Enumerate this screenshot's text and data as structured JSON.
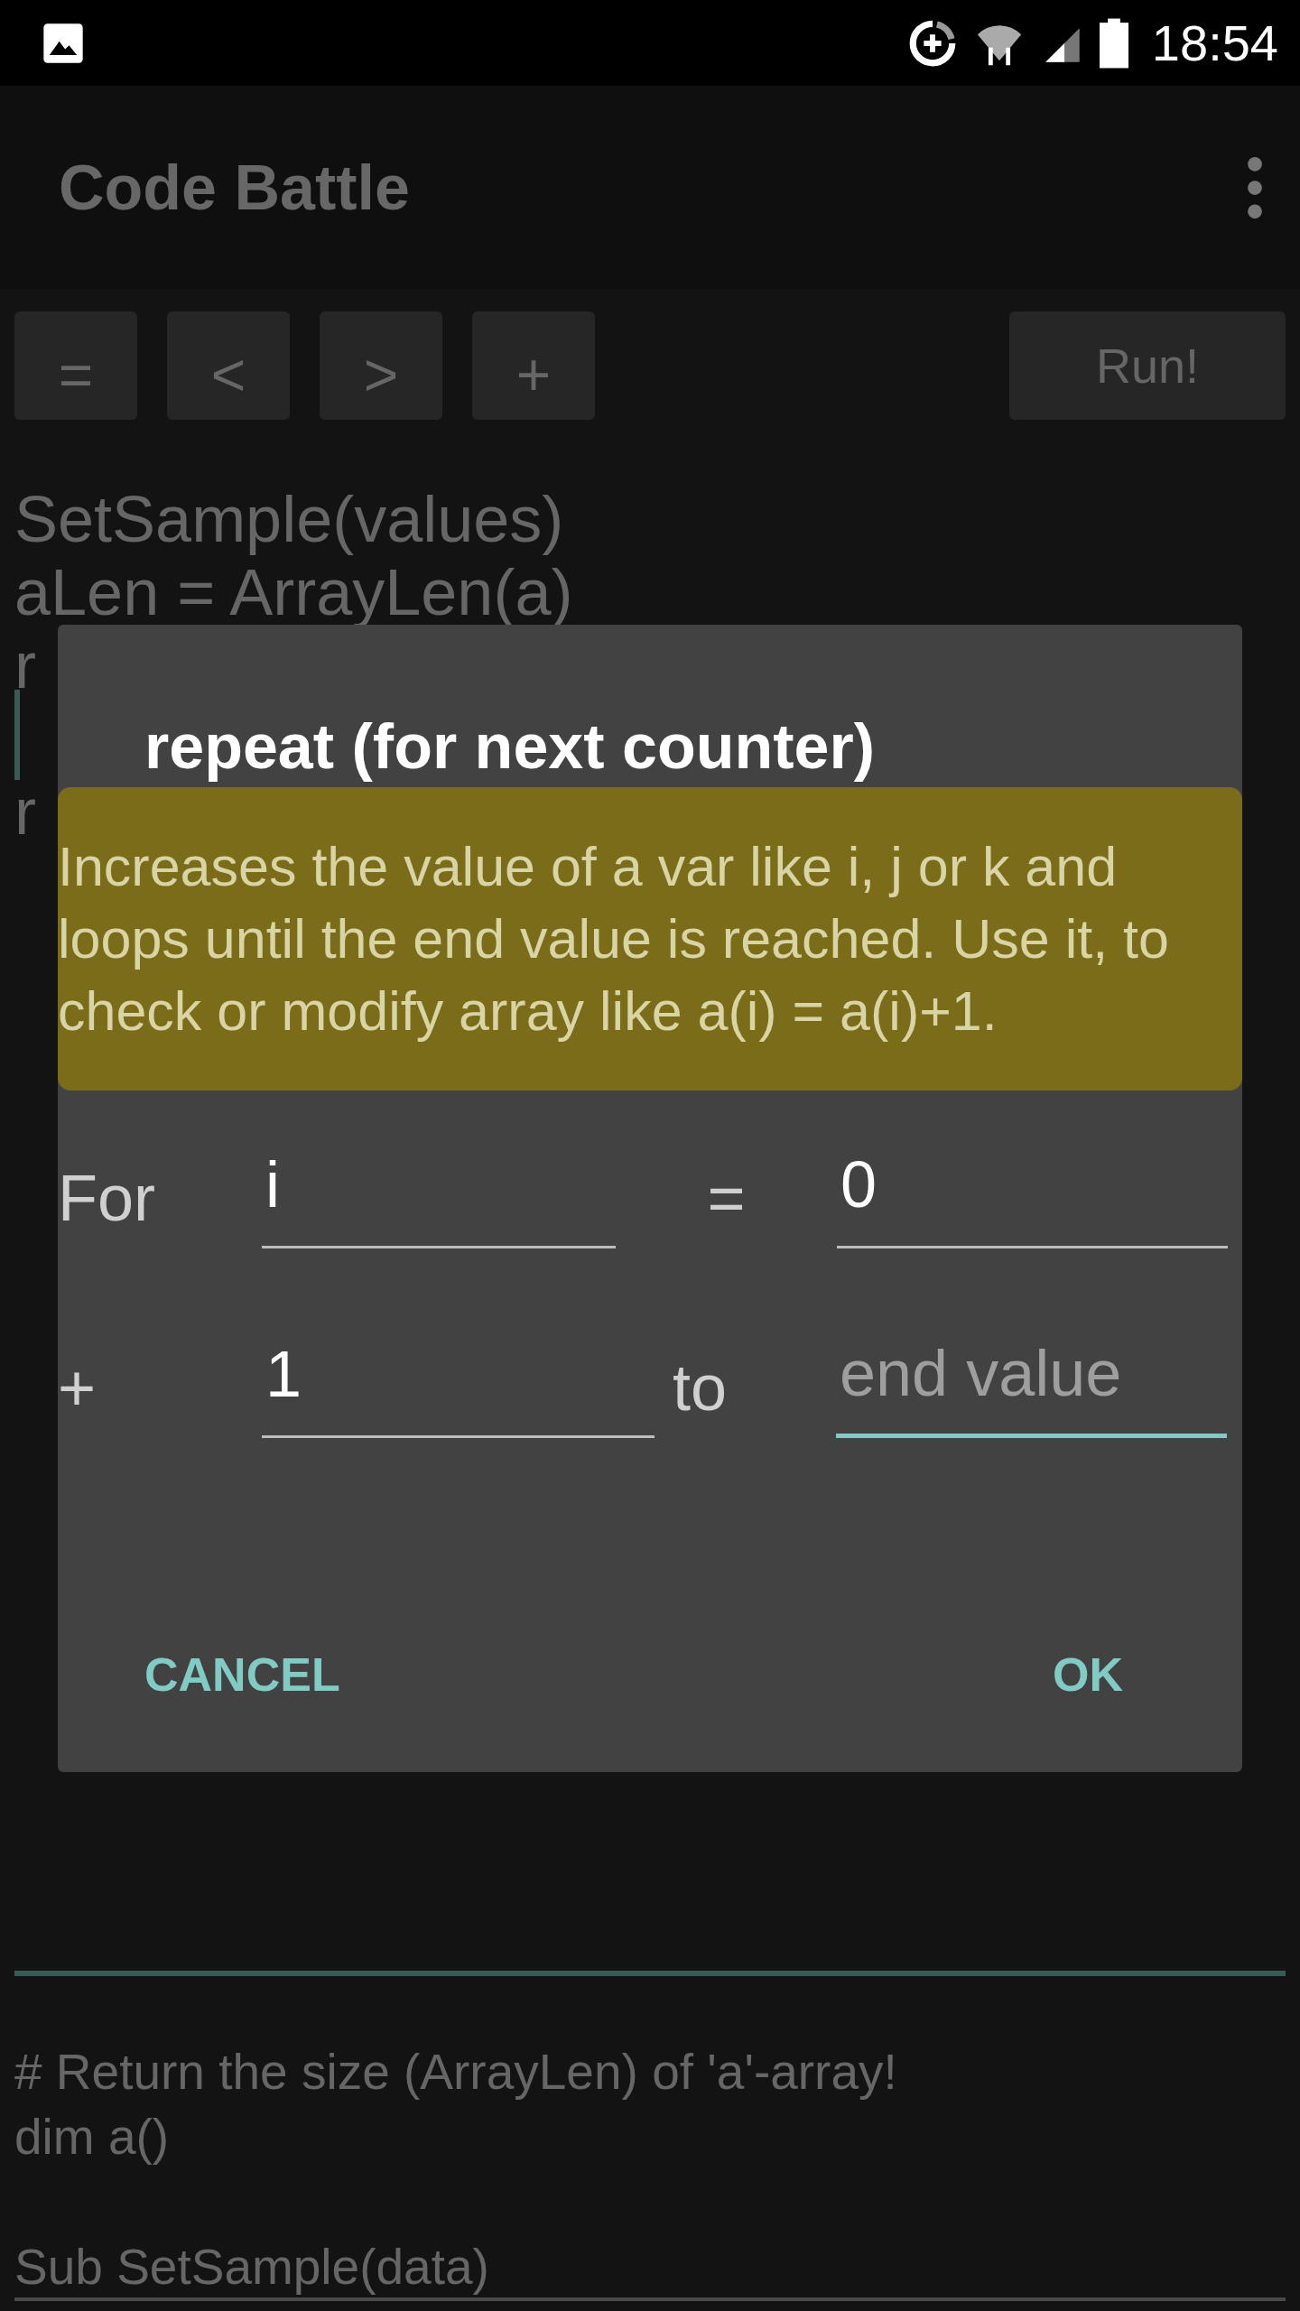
{
  "status_bar": {
    "time": "18:54"
  },
  "app_bar": {
    "title": "Code Battle"
  },
  "toolbar": {
    "buttons": [
      "=",
      "<",
      ">",
      "+"
    ],
    "run_button": "Run!"
  },
  "editor": {
    "lines": [
      {
        "text": "SetSample(values)",
        "kind": "code"
      },
      {
        "text": "aLen = ArrayLen(a)",
        "kind": "code"
      },
      {
        "text": "r",
        "kind": "code"
      },
      {
        "kind": "cursor"
      },
      {
        "text": "r",
        "kind": "code"
      }
    ]
  },
  "dialog": {
    "title": "repeat (for next counter)",
    "hint": "Increases the value of a var like i, j or k and loops until the end value is reached. Use it, to check or modify array like a(i) = a(i)+1.",
    "rows": [
      {
        "label": "For",
        "field": {
          "value": "i",
          "focused": false
        },
        "separator": "=",
        "field2": {
          "value": "0",
          "focused": false
        }
      },
      {
        "label": "+",
        "field": {
          "value": "1",
          "focused": false
        },
        "separator": "to",
        "field2": {
          "placeholder": "end value",
          "focused": true
        }
      }
    ],
    "buttons": [
      "CANCEL",
      "OK"
    ]
  },
  "output": {
    "lines": [
      {
        "kind": "code",
        "text": "# Return the size (ArrayLen) of 'a'-array!"
      },
      {
        "kind": "code",
        "text": "dim a()"
      },
      {
        "kind": "blank"
      },
      {
        "kind": "code",
        "text": "Sub SetSample(data)"
      }
    ]
  }
}
